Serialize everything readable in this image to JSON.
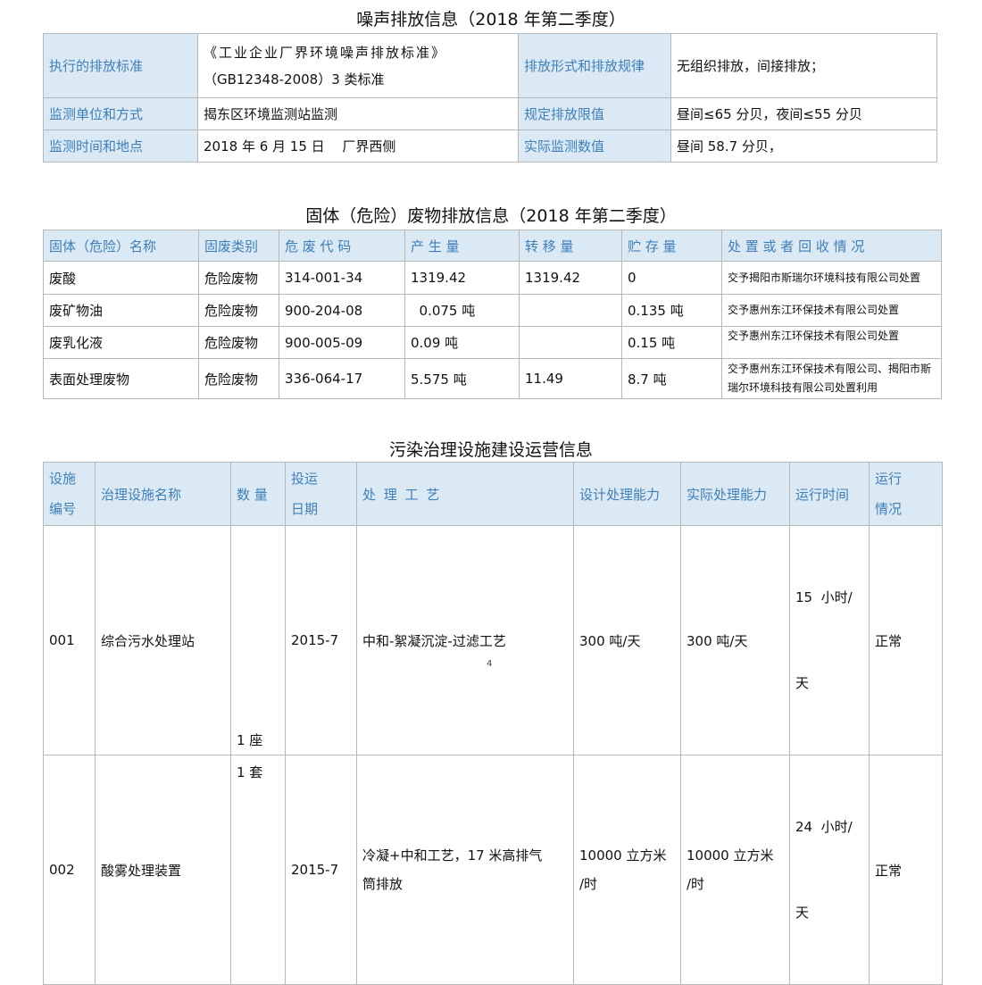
{
  "noise": {
    "title": "噪声排放信息（2018 年第二季度）",
    "rows": [
      {
        "h1": "执行的排放标准",
        "v1_line1": "《工业企业厂界环境噪声排放标准》",
        "v1_line2": "（GB12348-2008）3 类标准",
        "h2": "排放形式和排放规律",
        "v2": "无组织排放，间接排放；"
      },
      {
        "h1": "监测单位和方式",
        "v1": "揭东区环境监测站监测",
        "h2": "规定排放限值",
        "v2": "昼间≤65 分贝，夜间≤55 分贝"
      },
      {
        "h1": "监测时间和地点",
        "v1": "2018 年 6 月 15 日　 厂界西侧",
        "h2": "实际监测数值",
        "v2": "昼间 58.7 分贝，"
      }
    ]
  },
  "waste": {
    "title": "固体（危险）废物排放信息（2018 年第二季度）",
    "headers": [
      "固体（危险）名称",
      "固废类别",
      "危 废 代 码",
      "产 生 量",
      "转 移 量",
      "贮 存 量",
      "处 置 或 者 回 收 情 况"
    ],
    "rows": [
      [
        "废酸",
        "危险废物",
        "314-001-34",
        "1319.42",
        "1319.42",
        "0",
        "交予揭阳市斯瑞尔环境科技有限公司处置"
      ],
      [
        "废矿物油",
        "危险废物",
        "900-204-08",
        "  0.075 吨",
        "",
        "0.135 吨",
        "交予惠州东江环保技术有限公司处置"
      ],
      [
        "废乳化液",
        "危险废物",
        "900-005-09",
        "0.09 吨",
        "",
        "0.15 吨",
        "交予惠州东江环保技术有限公司处置"
      ],
      [
        "表面处理废物",
        "危险废物",
        "336-064-17",
        "5.575 吨",
        "11.49",
        "8.7 吨",
        "交予惠州东江环保技术有限公司、揭阳市斯瑞尔环境科技有限公司处置利用"
      ]
    ]
  },
  "facility": {
    "title": "污染治理设施建设运营信息",
    "headers": {
      "id_line1": "设施",
      "id_line2": "编号",
      "name": "治理设施名称",
      "qty": "数 量",
      "date_line1": "投运",
      "date_line2": "日期",
      "process": "处 理 工 艺",
      "design": "设计处理能力",
      "actual": "实际处理能力",
      "hours": "运行时间",
      "status_line1": "运行",
      "status_line2": "情况"
    },
    "rows": [
      {
        "id": "001",
        "name": "综合污水处理站",
        "qty": "1 座",
        "date": "2015-7",
        "process_line1": "中和-絮凝沉淀-过滤工艺",
        "process_line2": "",
        "design_line1": "300 吨/天",
        "design_line2": "",
        "actual_line1": "300 吨/天",
        "actual_line2": "",
        "hours_line1": "15  小时/",
        "hours_line2": "天",
        "status": "正常"
      },
      {
        "id": "002",
        "name": "酸雾处理装置",
        "qty": "1 套",
        "date": "2015-7",
        "process_line1": "冷凝+中和工艺，17 米高排气",
        "process_line2": "筒排放",
        "design_line1": "10000 立方米",
        "design_line2": "/时",
        "actual_line1": "10000 立方米",
        "actual_line2": "/时",
        "hours_line1": "24  小时/",
        "hours_line2": "天",
        "status": "正常"
      }
    ]
  },
  "page_number": "4"
}
